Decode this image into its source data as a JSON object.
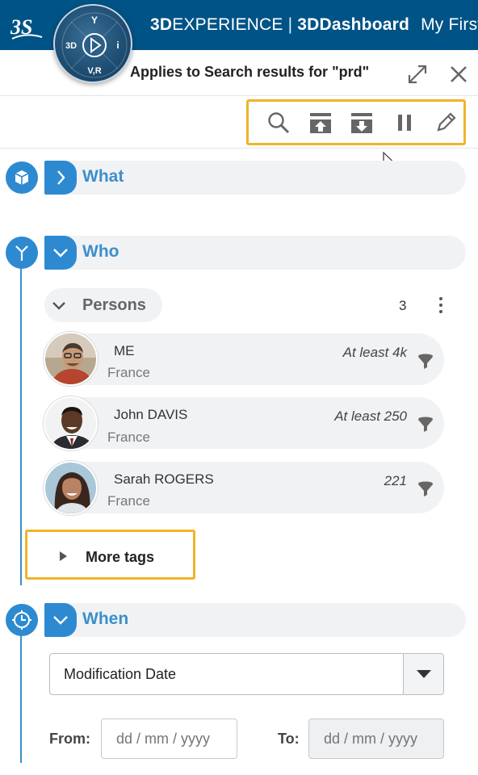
{
  "topbar": {
    "brand_bold": "3D",
    "brand_rest": "EXPERIENCE",
    "app_name": "3DDashboard",
    "dashboard_name": "My First D",
    "compass": {
      "top": "Y",
      "left": "3D",
      "right": "i",
      "bottom": "V,R"
    }
  },
  "panel": {
    "title": "Applies to Search results for \"prd\""
  },
  "toolbar": {
    "icons": [
      "search-icon",
      "expand-all-icon",
      "collapse-all-icon",
      "pause-icon",
      "edit-icon"
    ]
  },
  "sections": {
    "what": {
      "label": "What",
      "expanded": false
    },
    "who": {
      "label": "Who",
      "expanded": true
    },
    "when": {
      "label": "When",
      "expanded": true
    }
  },
  "persons": {
    "label": "Persons",
    "count": "3",
    "items": [
      {
        "name": "ME",
        "country": "France",
        "count": "At least 4k"
      },
      {
        "name": "John DAVIS",
        "country": "France",
        "count": "At least 250"
      },
      {
        "name": "Sarah ROGERS",
        "country": "France",
        "count": "221"
      }
    ]
  },
  "more_tags": {
    "label": "More tags"
  },
  "when": {
    "date_field": "Modification Date",
    "from_label": "From:",
    "to_label": "To:",
    "from_placeholder": "dd / mm / yyyy",
    "to_placeholder": "dd / mm / yyyy"
  },
  "colors": {
    "topbar": "#005386",
    "accent": "#2d8ad1",
    "highlight": "#f0b429"
  }
}
